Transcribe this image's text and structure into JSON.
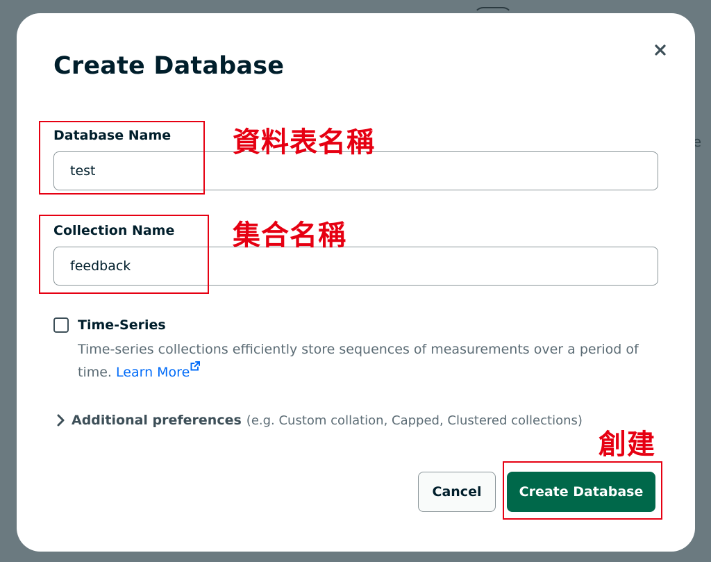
{
  "background": {
    "fragment": "e"
  },
  "modal": {
    "title": "Create Database",
    "close_icon": "close-icon",
    "database_name": {
      "label": "Database Name",
      "value": "test"
    },
    "collection_name": {
      "label": "Collection Name",
      "value": "feedback"
    },
    "time_series": {
      "label": "Time-Series",
      "checked": false,
      "description": "Time-series collections efficiently store sequences of measurements over a period of time.",
      "link_label": "Learn More"
    },
    "additional_preferences": {
      "label": "Additional preferences",
      "hint": "(e.g. Custom collation, Capped, Clustered collections)"
    },
    "buttons": {
      "cancel": "Cancel",
      "create": "Create Database"
    }
  },
  "annotations": {
    "database_name_note": "資料表名稱",
    "collection_name_note": "集合名稱",
    "create_note": "創建"
  },
  "colors": {
    "primary_button": "#00684a",
    "annotation": "#e60012",
    "link": "#016bf8",
    "overlay": "#6b7a80"
  }
}
